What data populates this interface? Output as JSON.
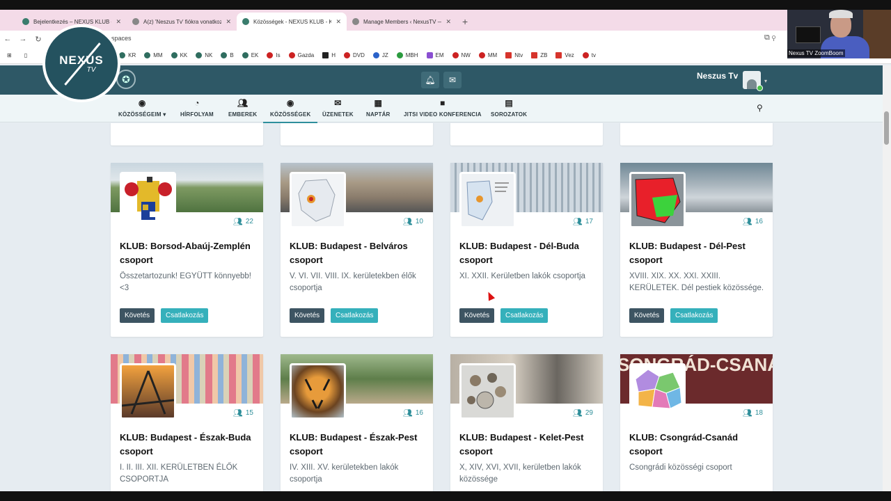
{
  "browser": {
    "tabs": [
      {
        "title": "Bejelentkezés – NEXUS KLUB – ..."
      },
      {
        "title": "A(z) 'Neszus Tv' fiókra vonatkoz..."
      },
      {
        "title": "Közösségek - NEXUS KLUB - Kö..."
      },
      {
        "title": "Manage Members ‹ NexusTV — ..."
      }
    ],
    "url_fragment": "spaces",
    "bookmarks": [
      "KR",
      "MM",
      "KK",
      "NK",
      "B",
      "EK",
      "Is",
      "Gazda",
      "H",
      "DVD",
      "JZ",
      "MBH",
      "EM",
      "NW",
      "MM",
      "Ntv",
      "ZB",
      "Vez",
      "tv"
    ]
  },
  "webcam": {
    "label": "Nexus TV ZoomBoom"
  },
  "site": {
    "logo_name": "NEXUS",
    "logo_sub": "TV",
    "user_name": "Neszus Tv",
    "menu": [
      {
        "label": "KÖZÖSSÉGEIM",
        "icon": "target-icon"
      },
      {
        "label": "HÍRFOLYAM",
        "icon": "dashboard-icon"
      },
      {
        "label": "EMBEREK",
        "icon": "users-icon"
      },
      {
        "label": "KÖZÖSSÉGEK",
        "icon": "target-icon"
      },
      {
        "label": "ÜZENETEK",
        "icon": "envelope-icon"
      },
      {
        "label": "NAPTÁR",
        "icon": "calendar-icon"
      },
      {
        "label": "JITSI VIDEO KONFERENCIA",
        "icon": "video-icon"
      },
      {
        "label": "SOROZATOK",
        "icon": "film-icon"
      }
    ]
  },
  "buttons": {
    "follow": "Követés",
    "join": "Csatlakozás"
  },
  "groups": [
    {
      "title": "KLUB: Borsod-Abaúj-Zemplén csoport",
      "desc": "Összetartozunk! EGYÜTT könnyebb! <3",
      "members": "22"
    },
    {
      "title": "KLUB: Budapest - Belváros csoport",
      "desc": "V. VI. VII. VIII. IX. kerületekben élők csoportja",
      "members": "10"
    },
    {
      "title": "KLUB: Budapest - Dél-Buda csoport",
      "desc": "XI. XXII. Kerületben lakók csoportja",
      "members": "17"
    },
    {
      "title": "KLUB: Budapest - Dél-Pest csoport",
      "desc": "XVIII. XIX. XX. XXI. XXIII. KERÜLETEK. Dél pestiek közössége.",
      "members": "16"
    },
    {
      "title": "KLUB: Budapest - Észak-Buda csoport",
      "desc": "I. II. III. XII. KERÜLETBEN ÉLŐK CSOPORTJA",
      "members": "15"
    },
    {
      "title": "KLUB: Budapest - Észak-Pest csoport",
      "desc": "IV. XIII. XV. kerületekben lakók csoportja",
      "members": "16"
    },
    {
      "title": "KLUB: Budapest - Kelet-Pest csoport",
      "desc": "X, XIV, XVI, XVII, kerületben lakók közössége",
      "members": "29"
    },
    {
      "title": "KLUB: Csongrád-Csanád csoport",
      "desc": "Csongrádi közösségi csoport",
      "members": "18"
    }
  ],
  "banner_text": "SONGRÁD-CSANÁD EGYE"
}
